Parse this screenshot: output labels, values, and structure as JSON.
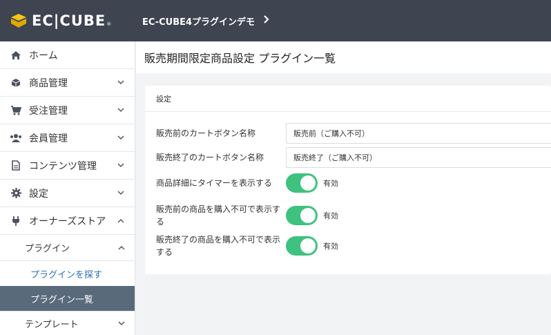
{
  "header": {
    "logo_text": "EC|CUBE",
    "logo_reg": "®",
    "shop_name": "EC-CUBE4プラグインデモ",
    "brand_color": "#f5c518"
  },
  "sidebar": {
    "items": [
      {
        "label": "ホーム",
        "icon": "home-icon"
      },
      {
        "label": "商品管理",
        "icon": "cube-icon"
      },
      {
        "label": "受注管理",
        "icon": "cart-icon"
      },
      {
        "label": "会員管理",
        "icon": "users-icon"
      },
      {
        "label": "コンテンツ管理",
        "icon": "file-icon"
      },
      {
        "label": "設定",
        "icon": "gear-icon"
      },
      {
        "label": "オーナーズストア",
        "icon": "plug-icon"
      }
    ],
    "sub": {
      "plugin": "プラグイン",
      "plugin_search": "プラグインを探す",
      "plugin_list": "プラグイン一覧",
      "template": "テンプレート"
    }
  },
  "page": {
    "title": "販売期間限定商品設定 プラグイン一覧"
  },
  "card": {
    "heading": "設定",
    "fields": [
      {
        "label": "販売前のカートボタン名称",
        "value": "販売前（ご購入不可）"
      },
      {
        "label": "販売終了のカートボタン名称",
        "value": "販売終了（ご購入不可）"
      }
    ],
    "toggles": [
      {
        "label": "商品詳細にタイマーを表示する",
        "state_label": "有効",
        "on": true
      },
      {
        "label": "販売前の商品を購入不可で表示する",
        "state_label": "有効",
        "on": true
      },
      {
        "label": "販売終了の商品を購入不可で表示する",
        "state_label": "有効",
        "on": true
      }
    ]
  },
  "colors": {
    "header_bg": "#3e4450",
    "toggle_on": "#3fc17f",
    "active_nav": "#596a7b",
    "link": "#2a6fb6"
  }
}
